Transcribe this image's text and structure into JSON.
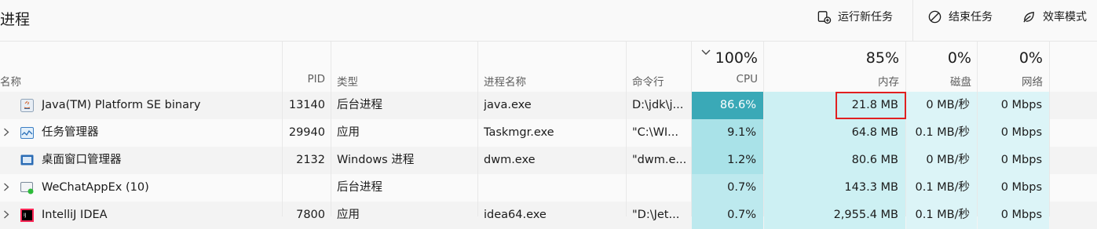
{
  "header": {
    "title": "进程",
    "actions": [
      {
        "label": "运行新任务",
        "icon": "run-new-task-icon"
      },
      {
        "label": "结束任务",
        "icon": "end-task-icon"
      },
      {
        "label": "效率模式",
        "icon": "efficiency-mode-icon"
      }
    ]
  },
  "columns": {
    "name": "名称",
    "pid": "PID",
    "type": "类型",
    "process_name": "进程名称",
    "command_line": "命令行",
    "cpu": {
      "pct": "100%",
      "label": "CPU",
      "sorted": "descending"
    },
    "memory": {
      "pct": "85%",
      "label": "内存"
    },
    "disk": {
      "pct": "0%",
      "label": "磁盘"
    },
    "network": {
      "pct": "0%",
      "label": "网络"
    }
  },
  "rows": [
    {
      "name": "Java(TM) Platform SE binary",
      "pid": "13140",
      "type": "后台进程",
      "process_name": "java.exe",
      "command": "D:\\jdk\\j...",
      "cpu": "86.6%",
      "memory": "21.8 MB",
      "disk": "0 MB/秒",
      "network": "0 Mbps",
      "expandable": false,
      "icon": "java-app-icon"
    },
    {
      "name": "任务管理器",
      "pid": "29940",
      "type": "应用",
      "process_name": "Taskmgr.exe",
      "command": "\"C:\\WI...",
      "cpu": "9.1%",
      "memory": "64.8 MB",
      "disk": "0.1 MB/秒",
      "network": "0 Mbps",
      "expandable": true,
      "icon": "task-manager-icon"
    },
    {
      "name": "桌面窗口管理器",
      "pid": "2132",
      "type": "Windows 进程",
      "process_name": "dwm.exe",
      "command": "\"dwm.e...",
      "cpu": "1.2%",
      "memory": "80.6 MB",
      "disk": "0 MB/秒",
      "network": "0 Mbps",
      "expandable": false,
      "icon": "desktop-window-manager-icon"
    },
    {
      "name": "WeChatAppEx (10)",
      "pid": "",
      "type": "后台进程",
      "process_name": "",
      "command": "",
      "cpu": "0.7%",
      "memory": "143.3 MB",
      "disk": "0.1 MB/秒",
      "network": "0 Mbps",
      "expandable": true,
      "icon": "wechat-app-icon"
    },
    {
      "name": "IntelliJ IDEA",
      "pid": "7800",
      "type": "应用",
      "process_name": "idea64.exe",
      "command": "\"D:\\Jet...",
      "cpu": "0.7%",
      "memory": "2,955.4 MB",
      "disk": "0.1 MB/秒",
      "network": "0 Mbps",
      "expandable": true,
      "icon": "intellij-idea-icon"
    }
  ],
  "colors": {
    "cpu_heat_high": "#3aa9b7",
    "cpu_heat_low": "#9fdfe6",
    "mem_heat": "#cdf0f3",
    "disk_net_heat": "#dcf4f7",
    "highlight_border": "#e02020"
  }
}
